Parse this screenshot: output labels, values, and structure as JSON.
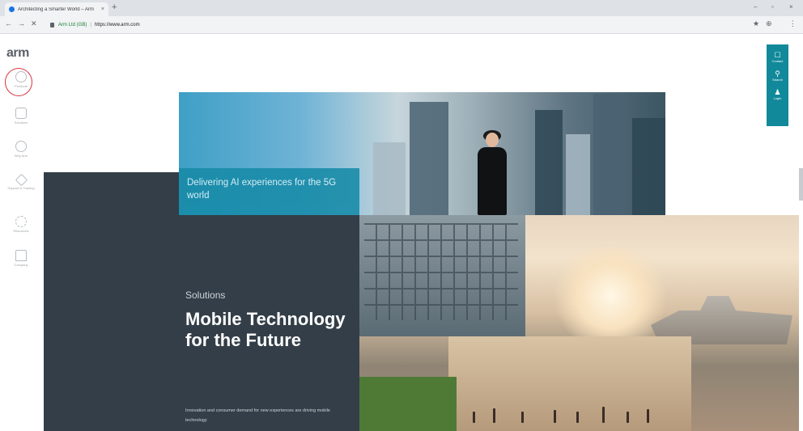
{
  "browser": {
    "tab_title": "Architecting a Smarter World – Arm",
    "tab_close": "×",
    "new_tab": "+",
    "window_controls": [
      "–",
      "▫",
      "×"
    ],
    "nav_buttons": [
      "←",
      "→",
      "✕"
    ],
    "secure_label": "Arm Ltd (GB)",
    "separator": "|",
    "url": "https://www.arm.com",
    "toolbar_icons": [
      "★",
      "⊕",
      "⋮"
    ]
  },
  "site": {
    "logo": "arm",
    "sidenav": [
      {
        "label": "Products",
        "icon": "circle-icon"
      },
      {
        "label": "Solutions",
        "icon": "solutions-icon"
      },
      {
        "label": "Why Arm",
        "icon": "info-icon"
      },
      {
        "label": "Support & Training",
        "icon": "support-icon"
      },
      {
        "label": "Resources",
        "icon": "resources-icon"
      },
      {
        "label": "Company",
        "icon": "company-icon"
      }
    ],
    "rightbar": [
      {
        "label": "Contact",
        "glyph": "☐"
      },
      {
        "label": "Search",
        "glyph": "⚲"
      },
      {
        "label": "Login",
        "glyph": "♟"
      }
    ]
  },
  "hero": {
    "caption": "Delivering AI experiences for the 5G world",
    "solutions_label": "Solutions",
    "title": "Mobile Technology for the Future",
    "body": "Innovation and consumer demand for new experiences are driving mobile technology"
  },
  "colors": {
    "accent": "#11899a",
    "dark_panel": "#333e48",
    "highlight_ring": "#d9363e"
  }
}
